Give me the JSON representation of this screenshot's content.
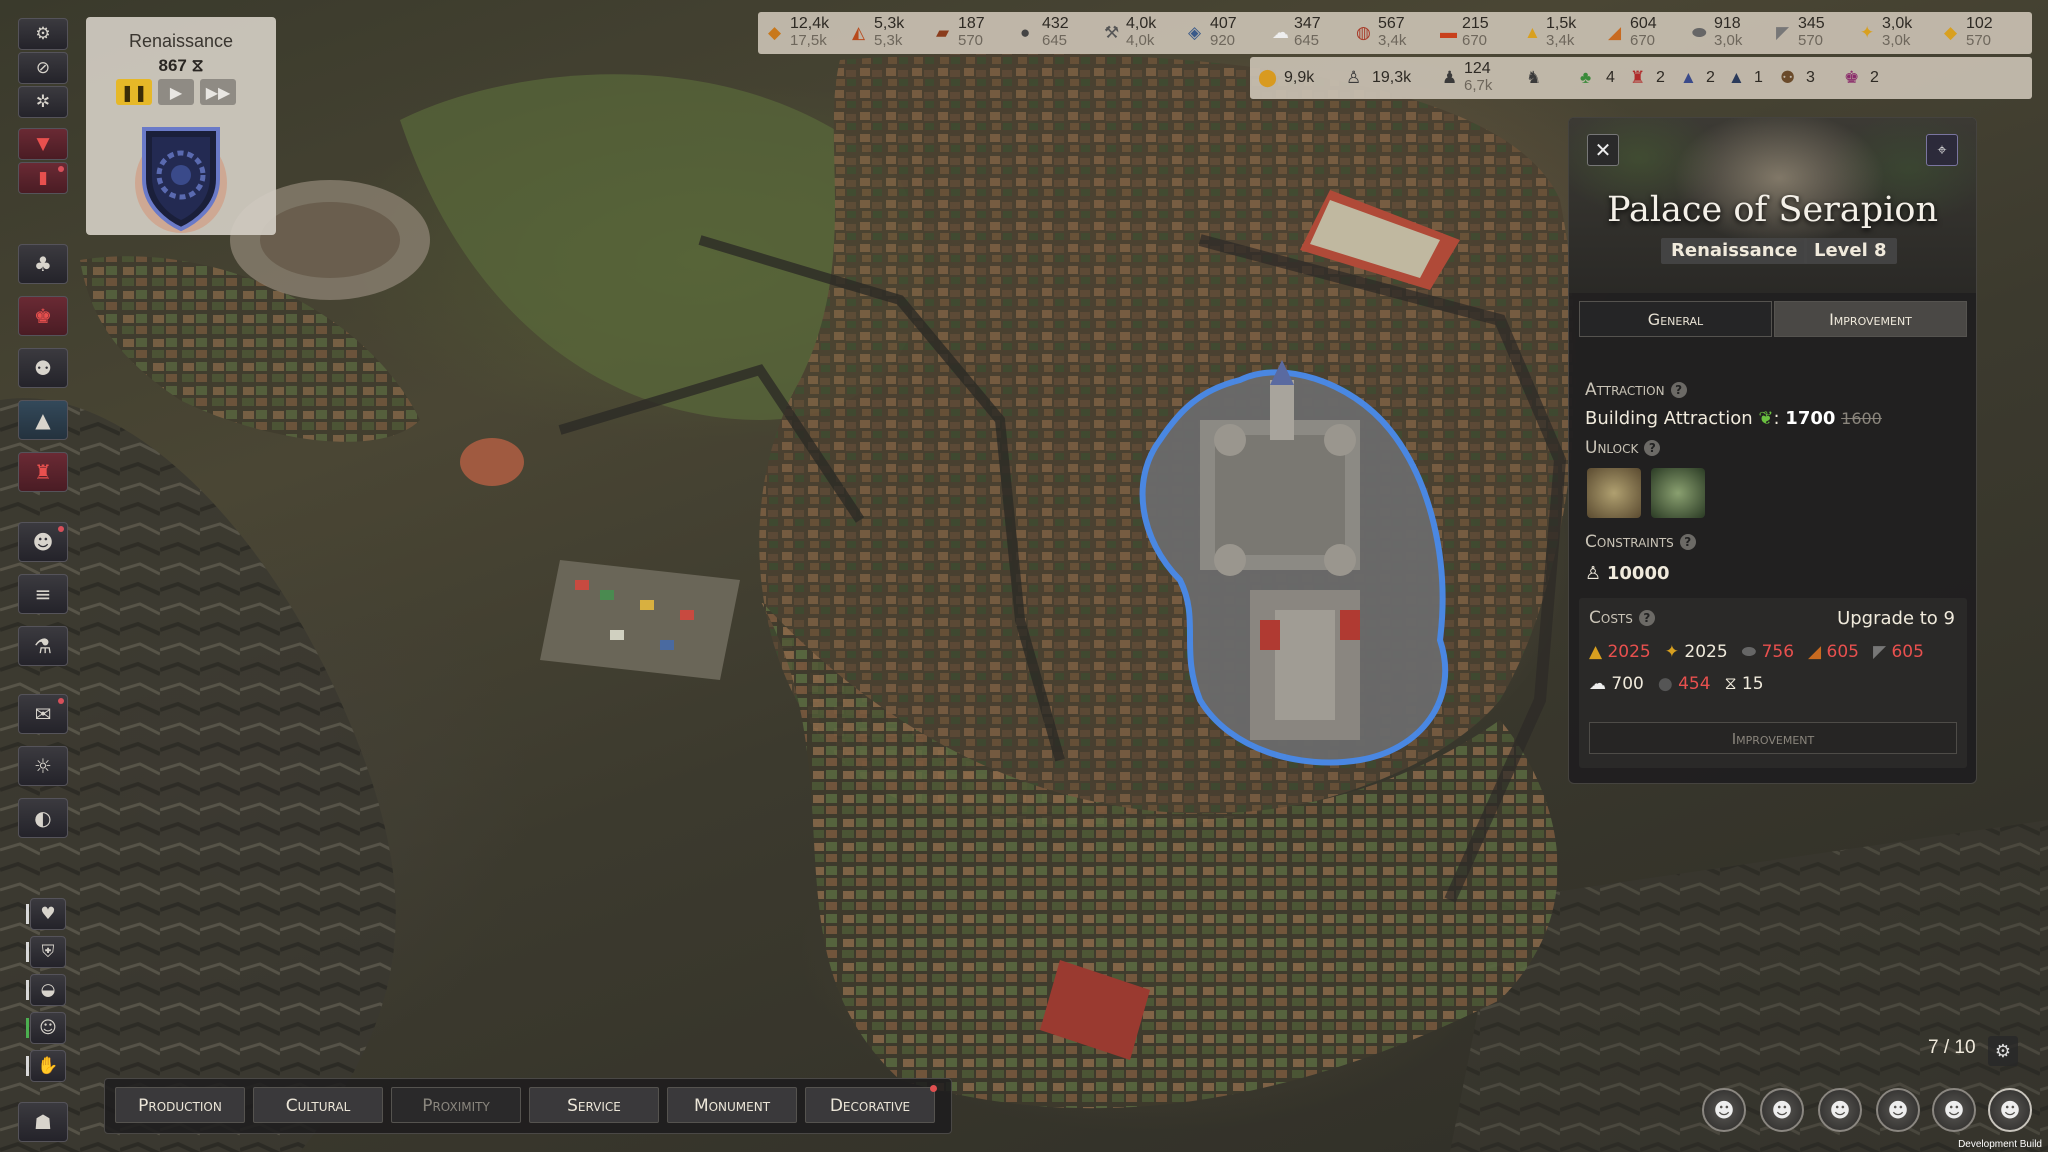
{
  "era": {
    "name": "Renaissance",
    "time": "867 ⧖"
  },
  "resources_top": [
    {
      "icon": "bread-icon",
      "value": "12,4k",
      "cap": "17,5k"
    },
    {
      "icon": "cheese-icon",
      "value": "5,3k",
      "cap": "5,3k"
    },
    {
      "icon": "log-icon",
      "value": "187",
      "cap": "570"
    },
    {
      "icon": "ore-icon",
      "value": "432",
      "cap": "645"
    },
    {
      "icon": "tools-icon",
      "value": "4,0k",
      "cap": "4,0k"
    },
    {
      "icon": "fish-icon",
      "value": "407",
      "cap": "920"
    },
    {
      "icon": "cloth-icon",
      "value": "347",
      "cap": "645"
    },
    {
      "icon": "meat-icon",
      "value": "567",
      "cap": "3,4k"
    },
    {
      "icon": "brick-icon",
      "value": "215",
      "cap": "670"
    },
    {
      "icon": "grain-icon",
      "value": "1,5k",
      "cap": "3,4k"
    },
    {
      "icon": "plank-icon",
      "value": "604",
      "cap": "670"
    },
    {
      "icon": "stone-icon",
      "value": "918",
      "cap": "3,0k"
    },
    {
      "icon": "iron-icon",
      "value": "345",
      "cap": "570"
    },
    {
      "icon": "gold-icon",
      "value": "3,0k",
      "cap": "3,0k"
    },
    {
      "icon": "jewel-icon",
      "value": "102",
      "cap": "570"
    }
  ],
  "resources_second": [
    {
      "icon": "coins-icon",
      "value": "9,9k"
    },
    {
      "icon": "population-icon",
      "value": "19,3k"
    },
    {
      "icon": "workers-icon",
      "value": "124",
      "cap": "6,7k"
    },
    {
      "icon": "idle-workers-icon",
      "value": ""
    },
    {
      "icon": "nature-icon",
      "value": "4"
    },
    {
      "icon": "trophy-icon",
      "value": "2"
    },
    {
      "icon": "tower-icon",
      "value": "2"
    },
    {
      "icon": "scholar-icon",
      "value": "1"
    },
    {
      "icon": "crowd-icon",
      "value": "3"
    },
    {
      "icon": "noble-icon",
      "value": "2"
    }
  ],
  "building": {
    "title": "Palace of Serapion",
    "era": "Renaissance",
    "level": "Level 8",
    "tabs": {
      "general": "General",
      "improvement": "Improvement"
    },
    "attraction_label": "Attraction",
    "attraction_text": "Building Attraction",
    "attraction_value": "1700",
    "attraction_old": "1600",
    "unlock_label": "Unlock",
    "constraints_label": "Constraints",
    "constraint_value": "10000",
    "costs_label": "Costs",
    "upgrade_to": "Upgrade to 9",
    "costs_row1": [
      {
        "icon": "grain-icon",
        "value": "2025",
        "sufficient": false
      },
      {
        "icon": "gold-icon",
        "value": "2025",
        "sufficient": true
      },
      {
        "icon": "stone-icon",
        "value": "756",
        "sufficient": false
      },
      {
        "icon": "plank-icon",
        "value": "605",
        "sufficient": false
      },
      {
        "icon": "iron-icon",
        "value": "605",
        "sufficient": false
      }
    ],
    "costs_row2": [
      {
        "icon": "cloth-icon",
        "value": "700",
        "sufficient": true
      },
      {
        "icon": "dark-resource-icon",
        "value": "454",
        "sufficient": false
      },
      {
        "icon": "hourglass-icon",
        "value": "15",
        "sufficient": true
      }
    ],
    "improvement_button": "Improvement"
  },
  "categories": [
    {
      "label": "Production",
      "enabled": true
    },
    {
      "label": "Cultural",
      "enabled": true
    },
    {
      "label": "Proximity",
      "enabled": false
    },
    {
      "label": "Service",
      "enabled": true
    },
    {
      "label": "Monument",
      "enabled": true
    },
    {
      "label": "Decorative",
      "enabled": true,
      "notification": true
    }
  ],
  "page_counter": "7 / 10",
  "dev_build": "Development Build",
  "colors": {
    "accent_gold": "#e6b828",
    "insufficient": "#e8504e",
    "selection_blue": "#4a8ae8"
  }
}
